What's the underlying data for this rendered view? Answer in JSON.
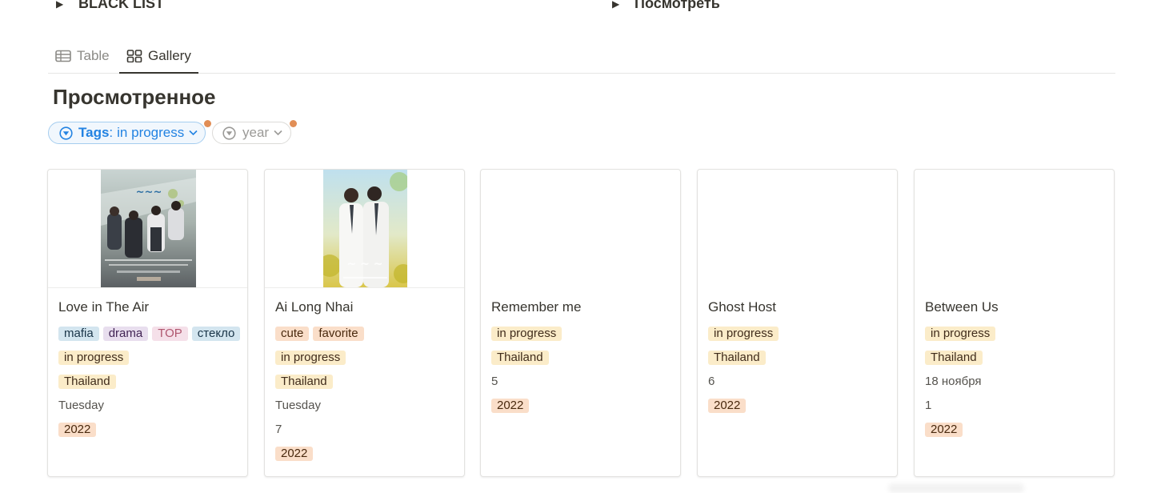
{
  "toggles": [
    {
      "label": "BLACK LIST"
    },
    {
      "label": "Посмотреть"
    }
  ],
  "views": [
    {
      "label": "Table",
      "icon": "table-icon"
    },
    {
      "label": "Gallery",
      "icon": "gallery-icon",
      "active": true
    }
  ],
  "title": "Просмотренное",
  "filters": {
    "tags": {
      "key": "Tags",
      "sep": ":",
      "value": "in progress"
    },
    "year": {
      "label": "year"
    }
  },
  "colors": {
    "accent": "#2383e2",
    "indicator": "#e18e56",
    "tag_blue": "#d3e5ef",
    "tag_purple": "#e8deee",
    "tag_pink": "#f5e0e9",
    "tag_yellow": "#fbecc9",
    "tag_orange": "#fadec9"
  },
  "cards": [
    {
      "title": "Love in The Air",
      "tags": [
        {
          "text": "mafia",
          "color": "#d3e5ef"
        },
        {
          "text": "drama",
          "color": "#e8deee"
        },
        {
          "text": "TOP",
          "color": "#f5e0e9"
        },
        {
          "text": "стекло",
          "color": "#d3e5ef"
        }
      ],
      "status": "in progress",
      "country": "Thailand",
      "day": "Tuesday",
      "episode": "",
      "year": "2022"
    },
    {
      "title": "Ai Long Nhai",
      "tags": [
        {
          "text": "cute",
          "color": "#fadec9"
        },
        {
          "text": "favorite",
          "color": "#fadec9"
        }
      ],
      "status": "in progress",
      "country": "Thailand",
      "day": "Tuesday",
      "episode": "7",
      "year": "2022"
    },
    {
      "title": "Remember me",
      "tags": [],
      "status": "in progress",
      "country": "Thailand",
      "day": "",
      "episode": "5",
      "year": "2022"
    },
    {
      "title": "Ghost Host",
      "tags": [],
      "status": "in progress",
      "country": "Thailand",
      "day": "",
      "episode": "6",
      "year": "2022"
    },
    {
      "title": "Between Us",
      "tags": [],
      "status": "in progress",
      "country": "Thailand",
      "day": "18 ноября",
      "episode": "1",
      "year": "2022"
    }
  ]
}
